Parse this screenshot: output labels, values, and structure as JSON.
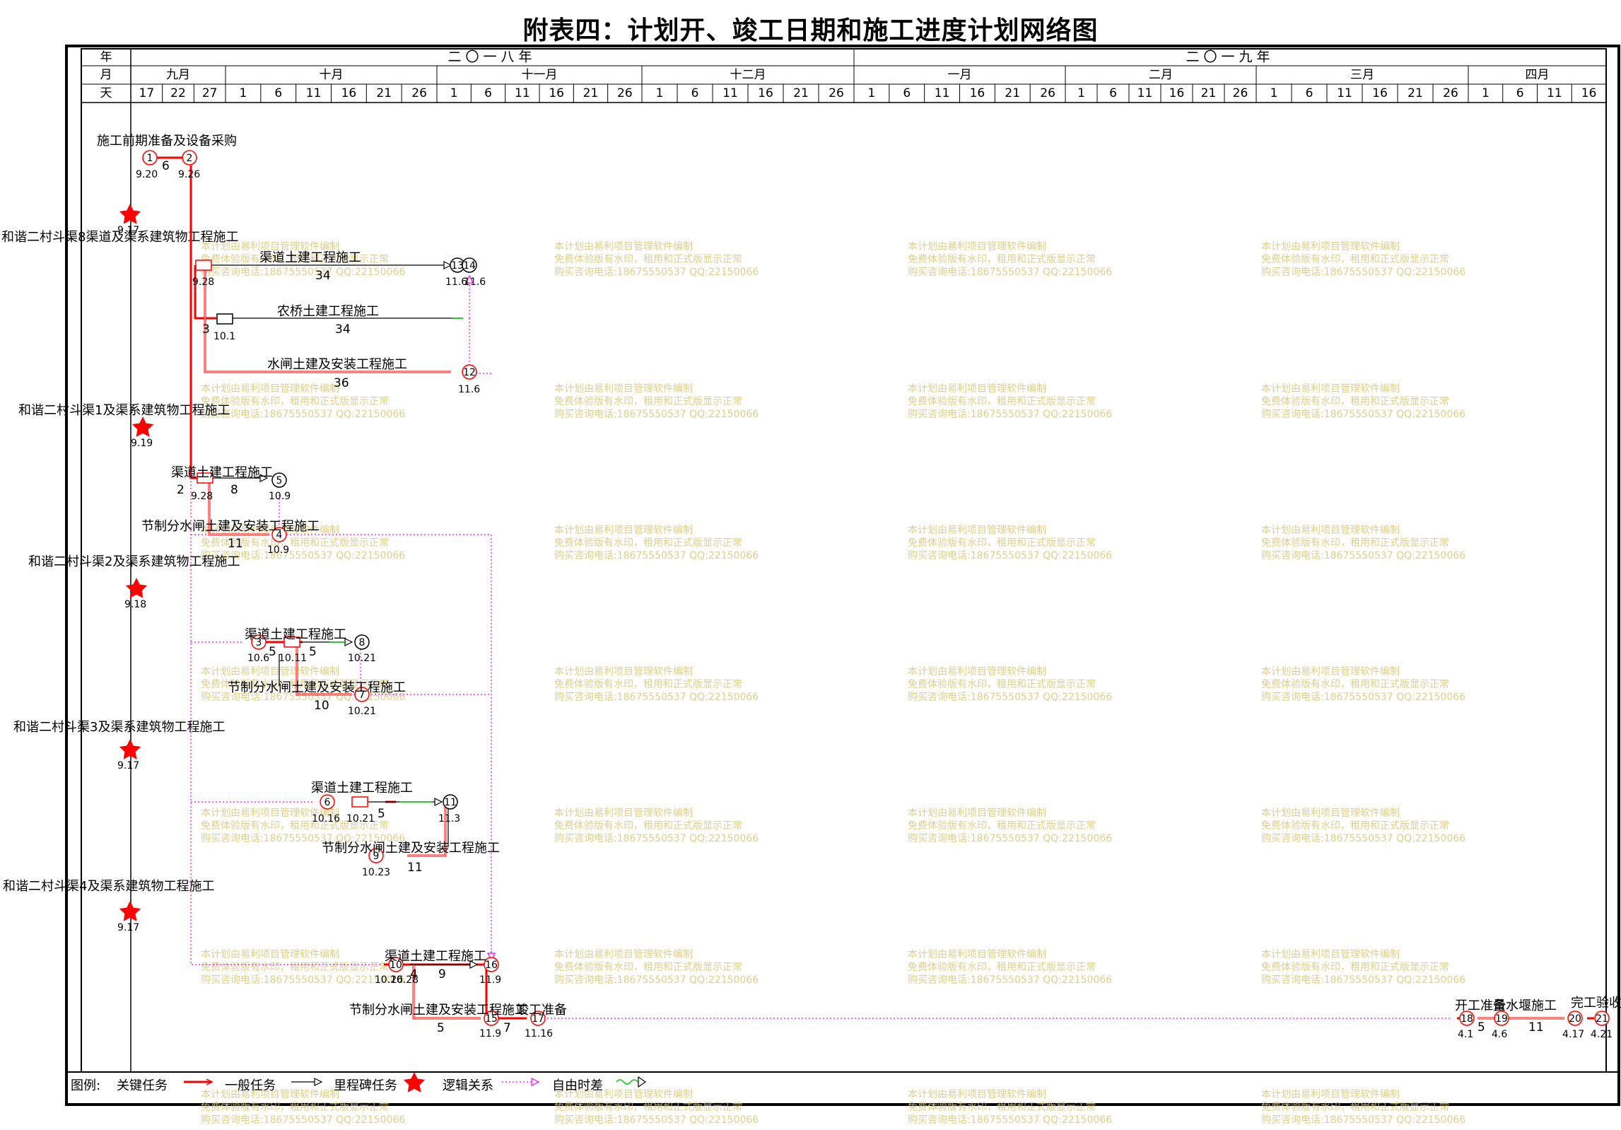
{
  "title": "附表四：计划开、竣工日期和施工进度计划网络图",
  "header": {
    "year_label": "年",
    "month_label": "月",
    "day_label": "天",
    "years": [
      "二〇一八年",
      "二〇一九年"
    ],
    "months": [
      "九月",
      "十月",
      "十一月",
      "十二月",
      "一月",
      "二月",
      "三月",
      "四月"
    ],
    "day_sets": [
      [
        "17",
        "22",
        "27"
      ],
      [
        "1",
        "6",
        "11",
        "16",
        "21",
        "26"
      ],
      [
        "1",
        "6",
        "11",
        "16",
        "21",
        "26"
      ],
      [
        "1",
        "6",
        "11",
        "16",
        "21",
        "26"
      ],
      [
        "1",
        "6",
        "11",
        "16",
        "21",
        "26"
      ],
      [
        "1",
        "6",
        "11",
        "16",
        "21",
        "26"
      ],
      [
        "1",
        "6",
        "11",
        "16",
        "21",
        "26"
      ],
      [
        "1",
        "6",
        "11",
        "16"
      ]
    ]
  },
  "groups": [
    {
      "label": "施工前期准备及设备采购"
    },
    {
      "label": "和谐二村斗渠8渠道及渠系建筑物工程施工",
      "milestone_date": "9.17"
    },
    {
      "label": "和谐二村斗渠1及渠系建筑物工程施工",
      "milestone_date": "9.19"
    },
    {
      "label": "和谐二村斗渠2及渠系建筑物工程施工",
      "milestone_date": "9.18"
    },
    {
      "label": "和谐二村斗渠3及渠系建筑物工程施工",
      "milestone_date": "9.17"
    },
    {
      "label": "和谐二村斗渠4及渠系建筑物工程施工",
      "milestone_date": "9.17"
    }
  ],
  "nodes": [
    {
      "id": "1",
      "date": "9.20"
    },
    {
      "id": "2",
      "date": "9.26"
    },
    {
      "id": "13",
      "date": "11.6"
    },
    {
      "id": "14",
      "date": "11.6"
    },
    {
      "id": "12",
      "date": "11.6"
    },
    {
      "id": "5",
      "date": "10.9"
    },
    {
      "id": "4",
      "date": "10.9"
    },
    {
      "id": "3",
      "date": "10.6"
    },
    {
      "id": "8",
      "date": "10.21"
    },
    {
      "id": "7",
      "date": "10.21"
    },
    {
      "id": "6",
      "date": "10.16"
    },
    {
      "id": "11",
      "date": "11.3"
    },
    {
      "id": "9",
      "date": "10.23"
    },
    {
      "id": "10",
      "date": "10.26"
    },
    {
      "id": "16",
      "date": "11.9"
    },
    {
      "id": "15",
      "date": "11.9"
    },
    {
      "id": "17",
      "date": "11.16"
    },
    {
      "id": "18",
      "date": "4.1"
    },
    {
      "id": "19",
      "date": "4.6"
    },
    {
      "id": "20",
      "date": "4.17"
    },
    {
      "id": "21",
      "date": "4.21"
    }
  ],
  "tasks": [
    {
      "name": "施工前期准备及设备采购",
      "duration": "6"
    },
    {
      "name": "渠道土建工程施工",
      "duration": "34"
    },
    {
      "name": "农桥土建工程施工",
      "duration": "34"
    },
    {
      "name": "水闸土建及安装工程施工",
      "duration": "36"
    },
    {
      "name": "渠道土建工程施工",
      "duration": "8"
    },
    {
      "name": "节制分水闸土建及安装工程施工",
      "duration": "11"
    },
    {
      "name": "渠道土建工程施工",
      "duration": "5"
    },
    {
      "name": "节制分水闸土建及安装工程施工",
      "duration": "10"
    },
    {
      "name": "渠道土建工程施工",
      "duration": "5"
    },
    {
      "name": "节制分水闸土建及安装工程施工",
      "duration": "11"
    },
    {
      "name": "渠道土建工程施工",
      "duration": "9"
    },
    {
      "name": "节制分水闸土建及安装工程施工",
      "duration": "7"
    },
    {
      "name": "竣工准备",
      "duration": ""
    },
    {
      "name": "开工准备",
      "duration": "5"
    },
    {
      "name": "量水堰施工",
      "duration": "11"
    },
    {
      "name": "完工验收",
      "duration": ""
    }
  ],
  "extra_dates": [
    "9.28",
    "10.1",
    "9.28",
    "10.11",
    "10.21",
    "10.28"
  ],
  "extra_numbers": [
    "3",
    "2",
    "5",
    "5",
    "4"
  ],
  "legend": {
    "title": "图例:",
    "items": [
      "关键任务",
      "一般任务",
      "里程碑任务",
      "逻辑关系",
      "自由时差"
    ]
  },
  "watermark": {
    "line1": "本计划由易利项目管理软件编制",
    "line2": "免费体验版有水印，租用和正式版显示正常",
    "line3": "购买咨询电话:18675550537 QQ:22150066"
  },
  "colors": {
    "critical": "#ff0000",
    "normal": "#000000",
    "logic": "#ff00ff",
    "float": "#00cc00",
    "watermark": "#d9c779"
  }
}
